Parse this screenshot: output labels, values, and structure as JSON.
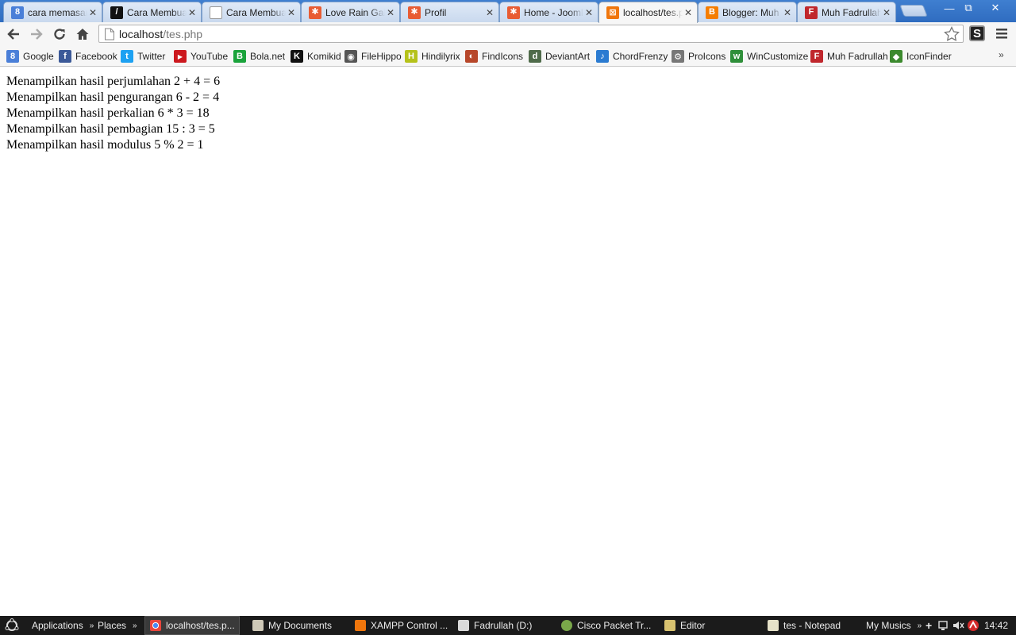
{
  "tabs": [
    {
      "title": "cara memasan",
      "icon": "google-favicon-icon",
      "color": "#4a7fd8",
      "glyph": "8"
    },
    {
      "title": "Cara Membuat",
      "icon": "black-page-favicon-icon",
      "color": "#111111",
      "glyph": "/"
    },
    {
      "title": "Cara Membuat",
      "icon": "blank-page-favicon-icon",
      "color": "#ffffff",
      "glyph": ""
    },
    {
      "title": "Love Rain Galle",
      "icon": "joomla-favicon-icon",
      "color": "#e85c33",
      "glyph": "✱"
    },
    {
      "title": "Profil",
      "icon": "joomla-favicon-icon",
      "color": "#e85c33",
      "glyph": "✱"
    },
    {
      "title": "Home - Joomla",
      "icon": "joomla-favicon-icon",
      "color": "#e85c33",
      "glyph": "✱"
    },
    {
      "title": "localhost/tes.p",
      "icon": "xampp-favicon-icon",
      "color": "#f0760c",
      "glyph": "⊠"
    },
    {
      "title": "Blogger: Muh F",
      "icon": "blogger-favicon-icon",
      "color": "#f57d00",
      "glyph": "B"
    },
    {
      "title": "Muh Fadrullah",
      "icon": "f-favicon-icon",
      "color": "#c0272d",
      "glyph": "F"
    }
  ],
  "address": {
    "host": "localhost",
    "path": "/tes.php"
  },
  "bookmarks": [
    {
      "label": "Google",
      "icon": "google-icon",
      "color": "#4a7fd8",
      "glyph": "8"
    },
    {
      "label": "Facebook",
      "icon": "facebook-icon",
      "color": "#3b5998",
      "glyph": "f"
    },
    {
      "label": "Twitter",
      "icon": "twitter-icon",
      "color": "#1da1f2",
      "glyph": "t"
    },
    {
      "label": "YouTube",
      "icon": "youtube-icon",
      "color": "#cc181e",
      "glyph": "▶"
    },
    {
      "label": "Bola.net",
      "icon": "bola-icon",
      "color": "#1aa33b",
      "glyph": "B"
    },
    {
      "label": "Komikid",
      "icon": "komikid-icon",
      "color": "#111111",
      "glyph": "K"
    },
    {
      "label": "FileHippo",
      "icon": "filehippo-icon",
      "color": "#555555",
      "glyph": "◉"
    },
    {
      "label": "Hindilyrix",
      "icon": "hindilyrix-icon",
      "color": "#b5c21a",
      "glyph": "H"
    },
    {
      "label": "FindIcons",
      "icon": "findicons-icon",
      "color": "#b7472a",
      "glyph": "◐"
    },
    {
      "label": "DeviantArt",
      "icon": "deviantart-icon",
      "color": "#4f6b4a",
      "glyph": "d"
    },
    {
      "label": "ChordFrenzy",
      "icon": "chordfrenzy-icon",
      "color": "#2b7bd1",
      "glyph": "♪"
    },
    {
      "label": "ProIcons",
      "icon": "proicons-icon",
      "color": "#777777",
      "glyph": "⚙"
    },
    {
      "label": "WinCustomize",
      "icon": "wincustomize-icon",
      "color": "#2f8f3a",
      "glyph": "w"
    },
    {
      "label": "Muh Fadrullah",
      "icon": "f-icon",
      "color": "#c0272d",
      "glyph": "F"
    },
    {
      "label": "IconFinder",
      "icon": "iconfinder-icon",
      "color": "#3c8a2e",
      "glyph": "◆"
    }
  ],
  "content": {
    "lines": [
      "Menampilkan hasil perjumlahan 2 + 4 = 6",
      "Menampilkan hasil pengurangan 6 - 2 = 4",
      "Menampilkan hasil perkalian 6 * 3 = 18",
      "Menampilkan hasil pembagian 15 : 3 = 5",
      "Menampilkan hasil modulus 5 % 2 = 1"
    ]
  },
  "taskbar": {
    "items": [
      {
        "label": "Applications",
        "icon": "",
        "arrow": true
      },
      {
        "label": "Places",
        "icon": "",
        "arrow": true
      },
      {
        "label": "localhost/tes.p...",
        "icon": "chrome-icon",
        "color": "#e8453c",
        "active": true
      },
      {
        "label": "My Documents",
        "icon": "folder-icon",
        "color": "#cfc9b8"
      },
      {
        "label": "XAMPP Control ...",
        "icon": "xampp-icon",
        "color": "#f0760c"
      },
      {
        "label": "Fadrullah (D:)",
        "icon": "drive-icon",
        "color": "#d9d9d9"
      },
      {
        "label": "Cisco Packet Tr...",
        "icon": "cisco-icon",
        "color": "#7aa84a"
      },
      {
        "label": "Editor",
        "icon": "editor-icon",
        "color": "#d8c270"
      },
      {
        "label": "tes - Notepad",
        "icon": "notepad-icon",
        "color": "#e6e2c9"
      },
      {
        "label": "My Musics",
        "icon": "",
        "arrow": true
      }
    ],
    "clock": "14:42"
  }
}
